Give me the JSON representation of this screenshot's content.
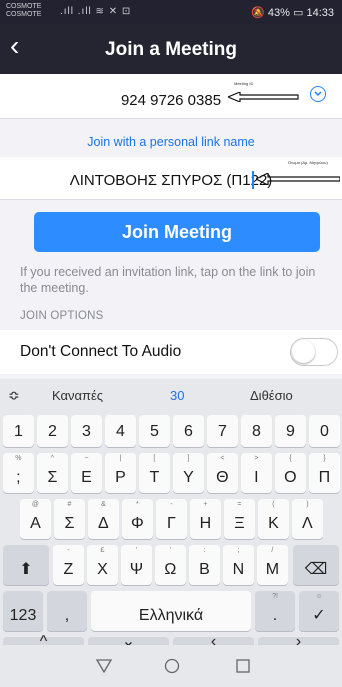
{
  "status": {
    "carrier1": "COSMOTE",
    "carrier2": "COSMOTE",
    "signal": ".ıll .ıll ≋ ✕ ⊡",
    "battery": "43%",
    "time": "14:33"
  },
  "header": {
    "title": "Join a Meeting"
  },
  "meeting": {
    "id_value": "924 9726 0385",
    "id_note": "Meeting ID",
    "link_label": "Join with a personal link name",
    "name_value": "ΛΙΝΤΟΒΟΗΣ ΣΠΥΡΟΣ (Π122)",
    "name_note": "Όνομα (Αρ. Μητρώου)"
  },
  "join_button": "Join Meeting",
  "hint": "If you received an invitation link, tap on the link to join the meeting.",
  "options_header": "JOIN OPTIONS",
  "audio_option": {
    "label": "Don't Connect To Audio",
    "enabled": false
  },
  "keyboard": {
    "suggestions": [
      "Καναπές",
      "30",
      "Διθέσιο"
    ],
    "row_numbers": [
      "1",
      "2",
      "3",
      "4",
      "5",
      "6",
      "7",
      "8",
      "9",
      "0"
    ],
    "row1": [
      [
        "%",
        ";"
      ],
      [
        "^",
        "Σ"
      ],
      [
        "~",
        "Ε"
      ],
      [
        "|",
        "Ρ"
      ],
      [
        "[",
        "Τ"
      ],
      [
        "]",
        "Υ"
      ],
      [
        "<",
        "Θ"
      ],
      [
        ">",
        "Ι"
      ],
      [
        "{",
        "Ο"
      ],
      [
        "}",
        "Π"
      ]
    ],
    "row2": [
      [
        "@",
        "Α"
      ],
      [
        "#",
        "Σ"
      ],
      [
        "&",
        "Δ"
      ],
      [
        "*",
        "Φ"
      ],
      [
        "-",
        "Γ"
      ],
      [
        "+",
        "Η"
      ],
      [
        "=",
        "Ξ"
      ],
      [
        "(",
        "Κ"
      ],
      [
        ")",
        "Λ"
      ]
    ],
    "row3": [
      [
        "-",
        "Ζ"
      ],
      [
        "£",
        "Χ"
      ],
      [
        "'",
        "Ψ"
      ],
      [
        "'",
        "Ω"
      ],
      [
        ":",
        "Β"
      ],
      [
        ";",
        "Ν"
      ],
      [
        "/",
        "Μ"
      ]
    ],
    "num_key": "123",
    "space_label": "Ελληνικά",
    "colors": {
      "accent": "#2d8cff",
      "header": "#252532"
    }
  }
}
